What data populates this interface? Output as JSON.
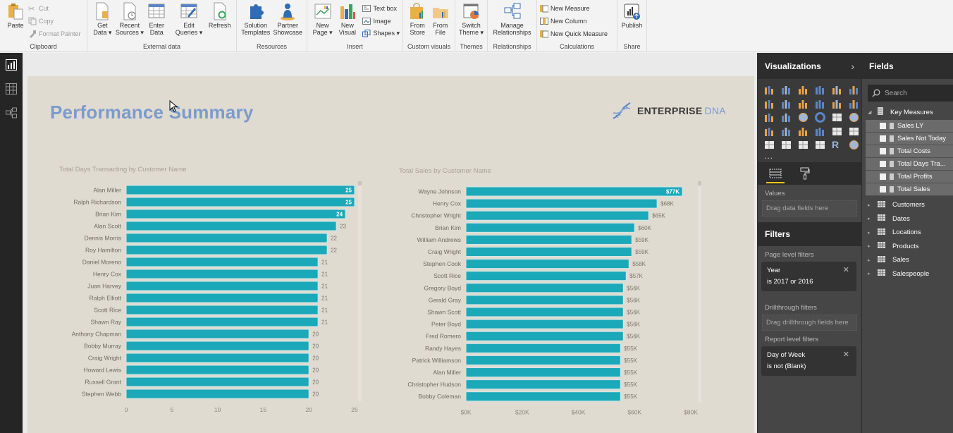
{
  "ribbon": {
    "clipboard": {
      "label": "Clipboard",
      "paste": "Paste",
      "cut": "Cut",
      "copy": "Copy",
      "format_painter": "Format Painter"
    },
    "external_data": {
      "label": "External data",
      "get_data": [
        "Get",
        "Data ▾"
      ],
      "recent_sources": [
        "Recent",
        "Sources ▾"
      ],
      "enter_data": [
        "Enter",
        "Data"
      ],
      "edit_queries": [
        "Edit",
        "Queries ▾"
      ],
      "refresh": "Refresh"
    },
    "resources": {
      "label": "Resources",
      "solution_templates": [
        "Solution",
        "Templates"
      ],
      "partner_showcase": [
        "Partner",
        "Showcase"
      ]
    },
    "insert": {
      "label": "Insert",
      "new_page": [
        "New",
        "Page ▾"
      ],
      "new_visual": [
        "New",
        "Visual"
      ],
      "text_box": "Text box",
      "image": "Image",
      "shapes": "Shapes ▾"
    },
    "custom_visuals": {
      "label": "Custom visuals",
      "from_store": [
        "From",
        "Store"
      ],
      "from_file": [
        "From",
        "File"
      ]
    },
    "themes": {
      "label": "Themes",
      "switch_theme": [
        "Switch",
        "Theme ▾"
      ]
    },
    "relationships": {
      "label": "Relationships",
      "manage": [
        "Manage",
        "Relationships"
      ]
    },
    "calculations": {
      "label": "Calculations",
      "new_measure": "New Measure",
      "new_column": "New Column",
      "new_quick_measure": "New Quick Measure"
    },
    "share": {
      "label": "Share",
      "publish": "Publish"
    }
  },
  "leftnav": {
    "items": [
      "report-view",
      "data-view",
      "relationships-view"
    ]
  },
  "report": {
    "title": "Performance Summary",
    "logo": {
      "part1": "ENTERPRISE",
      "part2": "DNA"
    },
    "bar_color": "#1ba8b8",
    "title_color": "#7a9bcc"
  },
  "chart_data": [
    {
      "type": "bar",
      "orientation": "horizontal",
      "title": "Total Days Transacting by Customer Name",
      "categories": [
        "Alan Miller",
        "Ralph Richardson",
        "Brian Kim",
        "Alan Scott",
        "Dennis Morris",
        "Roy Hamilton",
        "Daniel Moreno",
        "Henry Cox",
        "Juan Harvey",
        "Ralph Elliott",
        "Scott Rice",
        "Shawn Ray",
        "Anthony Chapman",
        "Bobby Murray",
        "Craig Wright",
        "Howard Lewis",
        "Russell Grant",
        "Stephen Webb"
      ],
      "values": [
        25,
        25,
        24,
        23,
        22,
        22,
        21,
        21,
        21,
        21,
        21,
        21,
        20,
        20,
        20,
        20,
        20,
        20
      ],
      "data_labels": [
        "25",
        "25",
        "24",
        "23",
        "22",
        "22",
        "21",
        "21",
        "21",
        "21",
        "21",
        "21",
        "20",
        "20",
        "20",
        "20",
        "20",
        "20"
      ],
      "xlim": [
        0,
        25
      ],
      "xticks": [
        0,
        5,
        10,
        15,
        20,
        25
      ],
      "xtick_labels": [
        "0",
        "5",
        "10",
        "15",
        "20",
        "25"
      ],
      "xlabel": "",
      "ylabel": "",
      "grid": false
    },
    {
      "type": "bar",
      "orientation": "horizontal",
      "title": "Total Sales by Customer Name",
      "categories": [
        "Wayne Johnson",
        "Henry Cox",
        "Christopher Wright",
        "Brian Kim",
        "William Andrews",
        "Craig Wright",
        "Stephen Cook",
        "Scott Rice",
        "Gregory Boyd",
        "Gerald Gray",
        "Shawn Scott",
        "Peter Boyd",
        "Fred Romero",
        "Randy Hayes",
        "Patrick Williamson",
        "Alan Miller",
        "Christopher Hudson",
        "Bobby Coleman"
      ],
      "values": [
        77,
        68,
        65,
        60,
        59,
        59,
        58,
        57,
        56,
        56,
        56,
        56,
        56,
        55,
        55,
        55,
        55,
        55
      ],
      "units": "$K",
      "data_labels": [
        "$77K",
        "$68K",
        "$65K",
        "$60K",
        "$59K",
        "$59K",
        "$58K",
        "$57K",
        "$56K",
        "$56K",
        "$56K",
        "$56K",
        "$56K",
        "$55K",
        "$55K",
        "$55K",
        "$55K",
        "$55K"
      ],
      "xlim": [
        0,
        80
      ],
      "xticks": [
        0,
        20,
        40,
        60,
        80
      ],
      "xtick_labels": [
        "$0K",
        "$20K",
        "$40K",
        "$60K",
        "$80K"
      ],
      "xlabel": "",
      "ylabel": "",
      "grid": false
    }
  ],
  "visualizations": {
    "title": "Visualizations",
    "more": "...",
    "values_label": "Values",
    "values_placeholder": "Drag data fields here"
  },
  "filters": {
    "title": "Filters",
    "page_level_label": "Page level filters",
    "page_filter": {
      "field": "Year",
      "condition": "is 2017 or 2016"
    },
    "drillthrough_label": "Drillthrough filters",
    "drillthrough_placeholder": "Drag drillthrough fields here",
    "report_level_label": "Report level filters",
    "report_filter": {
      "field": "Day of Week",
      "condition": "is not (Blank)"
    }
  },
  "fields": {
    "title": "Fields",
    "search_placeholder": "Search",
    "key_measures": {
      "name": "Key Measures",
      "items": [
        "Sales LY",
        "Sales Not Today",
        "Total Costs",
        "Total Days Tra...",
        "Total Profits",
        "Total Sales"
      ]
    },
    "tables": [
      "Customers",
      "Dates",
      "Locations",
      "Products",
      "Sales",
      "Salespeople"
    ]
  }
}
